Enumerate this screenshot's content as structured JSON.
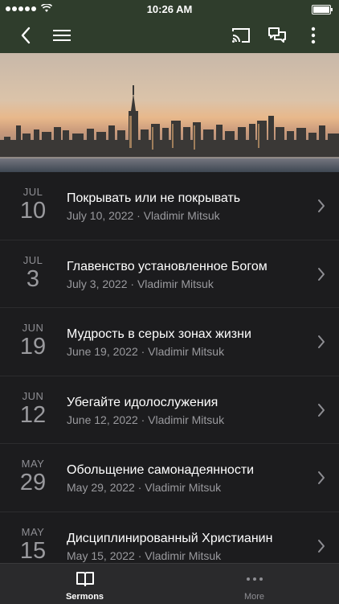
{
  "status": {
    "time": "10:26 AM"
  },
  "sermons": [
    {
      "month": "JUL",
      "day": "10",
      "title": "Покрывать или не покрывать",
      "meta": "July 10, 2022 · Vladimir Mitsuk"
    },
    {
      "month": "JUL",
      "day": "3",
      "title": "Главенство установленное Богом",
      "meta": "July 3, 2022 · Vladimir Mitsuk"
    },
    {
      "month": "JUN",
      "day": "19",
      "title": "Мудрость в серых зонах жизни",
      "meta": "June 19, 2022 · Vladimir Mitsuk"
    },
    {
      "month": "JUN",
      "day": "12",
      "title": "Убегайте идолослужения",
      "meta": "June 12, 2022 · Vladimir Mitsuk"
    },
    {
      "month": "MAY",
      "day": "29",
      "title": "Обольщение самонадеянности",
      "meta": "May 29, 2022 · Vladimir Mitsuk"
    },
    {
      "month": "MAY",
      "day": "15",
      "title": "Дисциплинированный Христианин",
      "meta": "May 15, 2022 · Vladimir Mitsuk"
    }
  ],
  "tabs": [
    {
      "label": "Sermons",
      "icon": "book-icon",
      "active": true
    },
    {
      "label": "More",
      "icon": "more-dots-icon",
      "active": false
    }
  ],
  "colors": {
    "header": "#2f3d2c",
    "background": "#1c1c1e",
    "tabbar": "#2a2a2c"
  }
}
